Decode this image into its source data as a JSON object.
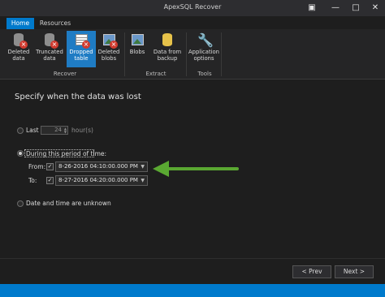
{
  "window": {
    "title": "ApexSQL Recover"
  },
  "ribbon": {
    "tabs": [
      {
        "label": "Home"
      },
      {
        "label": "Resources"
      }
    ],
    "buttons": {
      "deleted_data": "Deleted data",
      "truncated_data": "Truncated data",
      "dropped_table": "Dropped table",
      "deleted_blobs": "Deleted blobs",
      "blobs": "Blobs",
      "data_from_backup": "Data from backup",
      "application_options": "Application options"
    },
    "groups": {
      "recover": "Recover",
      "extract": "Extract",
      "tools": "Tools"
    }
  },
  "main": {
    "heading": "Specify when the data was lost",
    "last": {
      "label": "Last",
      "value": "24",
      "unit": "hour(s)"
    },
    "period": {
      "label": "During this period of time:",
      "from_label": "From:",
      "from_value": "8-26-2016 04:10:00.000 PM",
      "to_label": "To:",
      "to_value": "8-27-2016 04:20:00.000 PM"
    },
    "unknown": {
      "label": "Date and time are unknown"
    }
  },
  "footer": {
    "prev_label": "< Prev",
    "next_label": "Next >"
  },
  "colors": {
    "accent": "#007acc",
    "arrow": "#5aa832",
    "background": "#1e1e1e"
  }
}
